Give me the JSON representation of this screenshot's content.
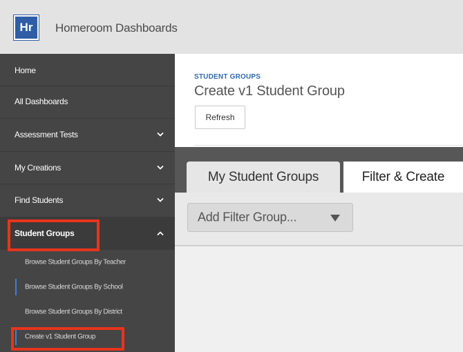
{
  "app": {
    "logo_text": "Hr",
    "title": "Homeroom Dashboards"
  },
  "sidebar": {
    "items": [
      {
        "label": "Home"
      },
      {
        "label": "All Dashboards"
      },
      {
        "label": "Assessment Tests",
        "icon": "chevron-down-icon"
      },
      {
        "label": "My Creations",
        "icon": "chevron-down-icon"
      },
      {
        "label": "Find Students",
        "icon": "chevron-down-icon"
      },
      {
        "label": "Student Groups",
        "icon": "chevron-up-icon",
        "expanded": true
      }
    ],
    "sub_items": [
      {
        "label": "Browse Student Groups By Teacher"
      },
      {
        "label": "Browse Student Groups By School"
      },
      {
        "label": "Browse Student Groups By District"
      },
      {
        "label": "Create v1 Student Group",
        "selected": true
      }
    ]
  },
  "main": {
    "breadcrumb": "STUDENT GROUPS",
    "title": "Create v1 Student Group",
    "refresh_label": "Refresh",
    "tabs": [
      {
        "label": "My Student Groups",
        "active": false
      },
      {
        "label": "Filter & Create",
        "active": true
      }
    ],
    "filter_select": {
      "value": "Add Filter Group..."
    }
  },
  "colors": {
    "accent": "#2f5da6",
    "link": "#2f69b3",
    "highlight": "#e8341c",
    "sidebar": "#454545"
  }
}
